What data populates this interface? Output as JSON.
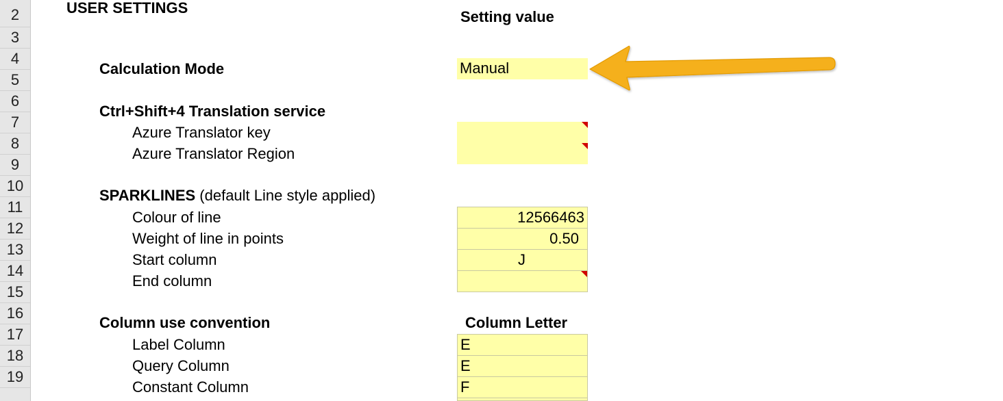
{
  "row_numbers": [
    "2",
    "3",
    "4",
    "5",
    "6",
    "7",
    "8",
    "9",
    "10",
    "11",
    "12",
    "13",
    "14",
    "15",
    "16",
    "17",
    "18",
    "19"
  ],
  "header": {
    "title": "USER SETTINGS",
    "setting_value_header": "Setting value"
  },
  "calculation_mode": {
    "label": "Calculation Mode",
    "value": "Manual"
  },
  "translation": {
    "heading": "Ctrl+Shift+4 Translation service",
    "key_label": "Azure Translator key",
    "key_value": "",
    "region_label": "Azure Translator Region",
    "region_value": ""
  },
  "sparklines": {
    "heading_bold": "SPARKLINES",
    "heading_rest": " (default Line style applied)",
    "colour_label": "Colour of line",
    "colour_value": "12566463",
    "weight_label": "Weight of line in points",
    "weight_value": "0.50",
    "start_label": "Start column",
    "start_value": "J",
    "end_label": "End column",
    "end_value": ""
  },
  "columns": {
    "heading": "Column use convention",
    "letter_header": "Column Letter",
    "label_col_label": "Label Column",
    "label_col_value": "E",
    "query_col_label": "Query Column",
    "query_col_value": "E",
    "constant_col_label": "Constant Column",
    "constant_col_value": "F"
  },
  "colors": {
    "input_fill": "#ffffa8",
    "arrow": "#f5b01c",
    "comment_marker": "#d00000"
  }
}
